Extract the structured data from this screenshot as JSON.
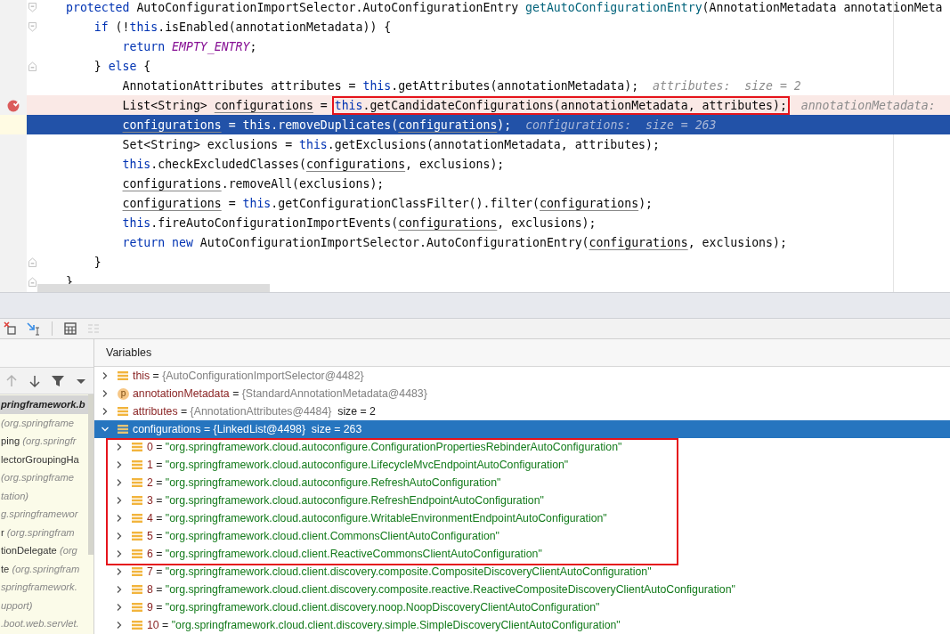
{
  "editor": {
    "lines": [
      {
        "fold_open": true,
        "fold_close": false,
        "breakpoint": false,
        "current": false,
        "tokens": [
          {
            "text": "protected",
            "kind": "keyword"
          },
          {
            "text": " AutoConfigurationImportSelector.AutoConfigurationEntry ",
            "kind": "plain"
          },
          {
            "text": "getAutoConfigurationEntry",
            "kind": "method"
          },
          {
            "text": "(AnnotationMetadata annotationMeta",
            "kind": "plain"
          }
        ]
      },
      {
        "fold_open": true,
        "fold_close": false,
        "breakpoint": false,
        "current": false,
        "tokens": [
          {
            "text": "    if",
            "kind": "keyword"
          },
          {
            "text": " (!",
            "kind": "plain"
          },
          {
            "text": "this",
            "kind": "keyword"
          },
          {
            "text": ".isEnabled(annotationMetadata)) {",
            "kind": "plain"
          }
        ]
      },
      {
        "fold_open": false,
        "fold_close": false,
        "breakpoint": false,
        "current": false,
        "tokens": [
          {
            "text": "        return ",
            "kind": "keyword"
          },
          {
            "text": "EMPTY_ENTRY",
            "kind": "constant"
          },
          {
            "text": ";",
            "kind": "plain"
          }
        ]
      },
      {
        "fold_open": false,
        "fold_close": true,
        "breakpoint": false,
        "current": false,
        "tokens": [
          {
            "text": "    } ",
            "kind": "plain"
          },
          {
            "text": "else",
            "kind": "keyword"
          },
          {
            "text": " {",
            "kind": "plain"
          }
        ]
      },
      {
        "fold_open": false,
        "fold_close": false,
        "breakpoint": false,
        "current": false,
        "tokens": [
          {
            "text": "        AnnotationAttributes attributes = ",
            "kind": "plain"
          },
          {
            "text": "this",
            "kind": "keyword"
          },
          {
            "text": ".getAttributes(annotationMetadata);",
            "kind": "plain"
          }
        ],
        "hint": "attributes:  size = 2"
      },
      {
        "fold_open": false,
        "fold_close": false,
        "breakpoint": true,
        "current": false,
        "tokens": [
          {
            "text": "        List<String> ",
            "kind": "plain"
          },
          {
            "text": "configurations",
            "kind": "field"
          },
          {
            "text": " = ",
            "kind": "plain"
          },
          {
            "kind": "boxed",
            "tokens": [
              {
                "text": "this",
                "kind": "keyword"
              },
              {
                "text": ".getCandidateConfigurations(annotationMetadata, attributes);",
                "kind": "plain"
              }
            ]
          }
        ],
        "hint": "annotationMetadata:"
      },
      {
        "fold_open": false,
        "fold_close": false,
        "breakpoint": false,
        "current": true,
        "tokens": [
          {
            "text": "        configurations",
            "kind": "field"
          },
          {
            "text": " = ",
            "kind": "plain"
          },
          {
            "text": "this",
            "kind": "keyword"
          },
          {
            "text": ".removeDuplicates(",
            "kind": "plain"
          },
          {
            "text": "configurations",
            "kind": "field"
          },
          {
            "text": ");",
            "kind": "plain"
          }
        ],
        "hint": "configurations:  size = 263"
      },
      {
        "fold_open": false,
        "fold_close": false,
        "breakpoint": false,
        "current": false,
        "tokens": [
          {
            "text": "        Set<String> exclusions = ",
            "kind": "plain"
          },
          {
            "text": "this",
            "kind": "keyword"
          },
          {
            "text": ".getExclusions(annotationMetadata, attributes);",
            "kind": "plain"
          }
        ]
      },
      {
        "fold_open": false,
        "fold_close": false,
        "breakpoint": false,
        "current": false,
        "tokens": [
          {
            "text": "        this",
            "kind": "keyword"
          },
          {
            "text": ".checkExcludedClasses(",
            "kind": "plain"
          },
          {
            "text": "configurations",
            "kind": "field"
          },
          {
            "text": ", exclusions);",
            "kind": "plain"
          }
        ]
      },
      {
        "fold_open": false,
        "fold_close": false,
        "breakpoint": false,
        "current": false,
        "tokens": [
          {
            "text": "        configurations",
            "kind": "field"
          },
          {
            "text": ".removeAll(exclusions);",
            "kind": "plain"
          }
        ]
      },
      {
        "fold_open": false,
        "fold_close": false,
        "breakpoint": false,
        "current": false,
        "tokens": [
          {
            "text": "        configurations",
            "kind": "field"
          },
          {
            "text": " = ",
            "kind": "plain"
          },
          {
            "text": "this",
            "kind": "keyword"
          },
          {
            "text": ".getConfigurationClassFilter().filter(",
            "kind": "plain"
          },
          {
            "text": "configurations",
            "kind": "field"
          },
          {
            "text": ");",
            "kind": "plain"
          }
        ]
      },
      {
        "fold_open": false,
        "fold_close": false,
        "breakpoint": false,
        "current": false,
        "tokens": [
          {
            "text": "        this",
            "kind": "keyword"
          },
          {
            "text": ".fireAutoConfigurationImportEvents(",
            "kind": "plain"
          },
          {
            "text": "configurations",
            "kind": "field"
          },
          {
            "text": ", exclusions);",
            "kind": "plain"
          }
        ]
      },
      {
        "fold_open": false,
        "fold_close": false,
        "breakpoint": false,
        "current": false,
        "tokens": [
          {
            "text": "        return new",
            "kind": "keyword"
          },
          {
            "text": " AutoConfigurationImportSelector.AutoConfigurationEntry(",
            "kind": "plain"
          },
          {
            "text": "configurations",
            "kind": "field"
          },
          {
            "text": ", exclusions);",
            "kind": "plain"
          }
        ]
      },
      {
        "fold_open": false,
        "fold_close": true,
        "breakpoint": false,
        "current": false,
        "tokens": [
          {
            "text": "    }",
            "kind": "plain"
          }
        ]
      },
      {
        "fold_open": false,
        "fold_close": true,
        "breakpoint": false,
        "current": false,
        "tokens": [
          {
            "text": "}",
            "kind": "plain"
          }
        ]
      }
    ]
  },
  "debug_toolbar": [
    {
      "kind": "remove",
      "disabled": false
    },
    {
      "kind": "jump-cursor",
      "disabled": false
    },
    {
      "kind": "grid",
      "disabled": false
    },
    {
      "kind": "lines",
      "disabled": true
    }
  ],
  "frames_toolbar": [
    {
      "kind": "up",
      "disabled": true
    },
    {
      "kind": "down",
      "disabled": false
    },
    {
      "kind": "filter",
      "disabled": false
    },
    {
      "kind": "caret",
      "disabled": false
    }
  ],
  "frames": [
    {
      "location": "pringframework.b",
      "selected": true
    },
    {
      "location": "(org.springframe",
      "selected": false
    },
    {
      "method": "ping",
      "location": "(org.springfr",
      "selected": false
    },
    {
      "method": "lectorGroupingHa",
      "selected": false
    },
    {
      "location": "(org.springframe",
      "selected": false
    },
    {
      "location": "tation)",
      "selected": false
    },
    {
      "location": "g.springframewor",
      "selected": false
    },
    {
      "method": "r",
      "location": "(org.springfram",
      "selected": false
    },
    {
      "method": "tionDelegate",
      "location": "(org",
      "selected": false
    },
    {
      "method": "te",
      "location": "(org.springfram",
      "selected": false
    },
    {
      "location": "springframework.",
      "selected": false
    },
    {
      "location": "upport)",
      "selected": false
    },
    {
      "location": ".boot.web.servlet.",
      "selected": false
    }
  ],
  "variables_panel": {
    "title": "Variables"
  },
  "variables": [
    {
      "name": "this",
      "separator": "=",
      "kind": "field",
      "value": "{AutoConfigurationImportSelector@4482}",
      "expanded": false,
      "selected": false
    },
    {
      "name": "annotationMetadata",
      "separator": "=",
      "kind": "parameter",
      "badge": "p",
      "value": "{StandardAnnotationMetadata@4483}",
      "expanded": false,
      "selected": false
    },
    {
      "name": "attributes",
      "separator": "=",
      "kind": "field",
      "value": "{AnnotationAttributes@4484}",
      "extra": "size = 2",
      "expanded": false,
      "selected": false
    },
    {
      "name": "configurations",
      "separator": "=",
      "kind": "field",
      "value": "{LinkedList@4498}",
      "extra": "size = 263",
      "expanded": true,
      "selected": true,
      "children": [
        {
          "name": "0",
          "separator": "=",
          "kind": "string",
          "value": "\"org.springframework.cloud.autoconfigure.ConfigurationPropertiesRebinderAutoConfiguration\"",
          "expanded": false,
          "selected": false,
          "boxed": true
        },
        {
          "name": "1",
          "separator": "=",
          "kind": "string",
          "value": "\"org.springframework.cloud.autoconfigure.LifecycleMvcEndpointAutoConfiguration\"",
          "expanded": false,
          "selected": false,
          "boxed": true
        },
        {
          "name": "2",
          "separator": "=",
          "kind": "string",
          "value": "\"org.springframework.cloud.autoconfigure.RefreshAutoConfiguration\"",
          "expanded": false,
          "selected": false,
          "boxed": true
        },
        {
          "name": "3",
          "separator": "=",
          "kind": "string",
          "value": "\"org.springframework.cloud.autoconfigure.RefreshEndpointAutoConfiguration\"",
          "expanded": false,
          "selected": false,
          "boxed": true
        },
        {
          "name": "4",
          "separator": "=",
          "kind": "string",
          "value": "\"org.springframework.cloud.autoconfigure.WritableEnvironmentEndpointAutoConfiguration\"",
          "expanded": false,
          "selected": false,
          "boxed": true
        },
        {
          "name": "5",
          "separator": "=",
          "kind": "string",
          "value": "\"org.springframework.cloud.client.CommonsClientAutoConfiguration\"",
          "expanded": false,
          "selected": false,
          "boxed": true
        },
        {
          "name": "6",
          "separator": "=",
          "kind": "string",
          "value": "\"org.springframework.cloud.client.ReactiveCommonsClientAutoConfiguration\"",
          "expanded": false,
          "selected": false,
          "boxed": true
        },
        {
          "name": "7",
          "separator": "=",
          "kind": "string",
          "value": "\"org.springframework.cloud.client.discovery.composite.CompositeDiscoveryClientAutoConfiguration\"",
          "expanded": false,
          "selected": false,
          "boxed": false
        },
        {
          "name": "8",
          "separator": "=",
          "kind": "string",
          "value": "\"org.springframework.cloud.client.discovery.composite.reactive.ReactiveCompositeDiscoveryClientAutoConfiguration\"",
          "expanded": false,
          "selected": false,
          "boxed": false
        },
        {
          "name": "9",
          "separator": "=",
          "kind": "string",
          "value": "\"org.springframework.cloud.client.discovery.noop.NoopDiscoveryClientAutoConfiguration\"",
          "expanded": false,
          "selected": false,
          "boxed": false
        },
        {
          "name": "10",
          "separator": "=",
          "kind": "string",
          "value": "\"org.springframework.cloud.client.discovery.simple.SimpleDiscoveryClientAutoConfiguration\"",
          "expanded": false,
          "selected": false,
          "boxed": false
        }
      ]
    }
  ]
}
